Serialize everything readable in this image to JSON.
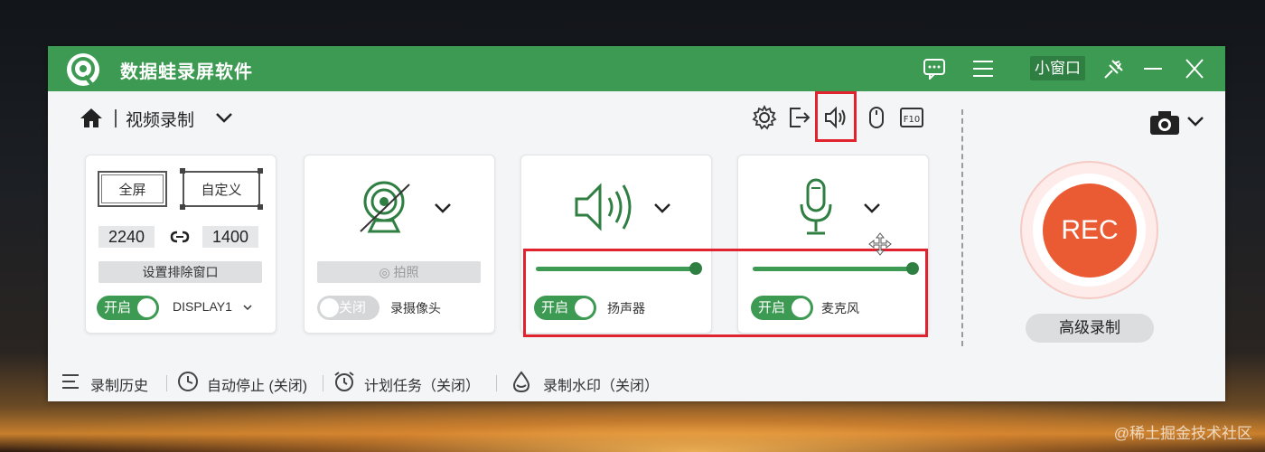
{
  "app": {
    "title": "数据蛙录屏软件"
  },
  "titlebar": {
    "small_window_label": "小窗口"
  },
  "toolbar": {
    "mode_label": "视频录制"
  },
  "screen_card": {
    "fullscreen_label": "全屏",
    "custom_label": "自定义",
    "width": "2240",
    "height": "1400",
    "exclude_window_label": "设置排除窗口",
    "toggle_label": "开启",
    "display_label": "DISPLAY1"
  },
  "camera_card": {
    "photo_label": "拍照",
    "toggle_label": "关闭",
    "label": "录摄像头"
  },
  "speaker_card": {
    "toggle_label": "开启",
    "label": "扬声器",
    "volume": 1.0
  },
  "mic_card": {
    "toggle_label": "开启",
    "label": "麦克风",
    "volume": 1.0
  },
  "record": {
    "rec_label": "REC",
    "advanced_label": "高级录制"
  },
  "bottom_bar": {
    "history_label": "录制历史",
    "auto_stop_label": "自动停止 (关闭)",
    "schedule_label": "计划任务（关闭）",
    "watermark_label": "录制水印（关闭）"
  },
  "watermark_text": "@稀土掘金技术社区",
  "colors": {
    "accent_green": "#3d9a52",
    "rec_orange": "#ea5b33",
    "highlight_red": "#e0232e"
  }
}
